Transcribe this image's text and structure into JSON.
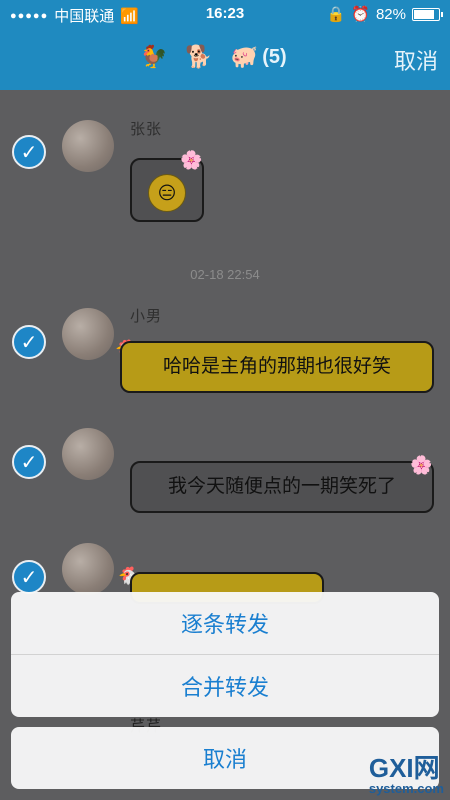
{
  "status": {
    "carrier": "中国联通",
    "time": "16:23",
    "battery": "82%",
    "battery_fill_fraction": 0.82
  },
  "navbar": {
    "emoji_1": "🐓",
    "emoji_2": "🐕",
    "emoji_3": "🐖",
    "count": "(5)",
    "cancel": "取消"
  },
  "messages": [
    {
      "name": "张张",
      "type": "emoji"
    },
    {
      "name": "小男",
      "text": "哈哈是主角的那期也很好笑",
      "type": "text"
    },
    {
      "name": "",
      "text": "我今天随便点的一期笑死了",
      "type": "text"
    },
    {
      "name": "",
      "type": "sticker"
    }
  ],
  "timestamp": "02-18 22:54",
  "hidden_row_name": "芹芹",
  "sheet": {
    "forward_one_by_one": "逐条转发",
    "forward_merged": "合并转发",
    "cancel": "取消"
  },
  "watermark": {
    "logo": "GXI网",
    "site": "system.com"
  }
}
